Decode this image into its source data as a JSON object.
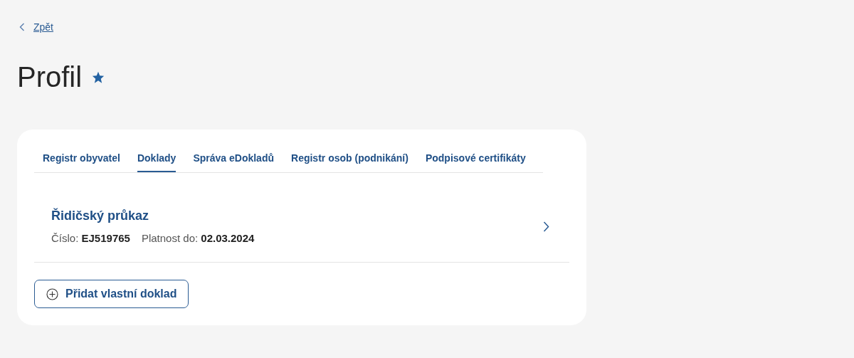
{
  "back_link": {
    "label": "Zpět"
  },
  "page": {
    "title": "Profil",
    "favorite": true
  },
  "tabs": [
    {
      "label": "Registr obyvatel",
      "selected": false
    },
    {
      "label": "Doklady",
      "selected": true
    },
    {
      "label": "Správa eDokladů",
      "selected": false
    },
    {
      "label": "Registr osob (podnikání)",
      "selected": false
    },
    {
      "label": "Podpisové certifikáty",
      "selected": false
    }
  ],
  "documents": [
    {
      "title": "Řidičský průkaz",
      "details": [
        "Číslo: **EJ519765**",
        "Platnost do: **02.03.2024**"
      ]
    }
  ],
  "add_button": {
    "label": "Přidat vlastní doklad"
  }
}
